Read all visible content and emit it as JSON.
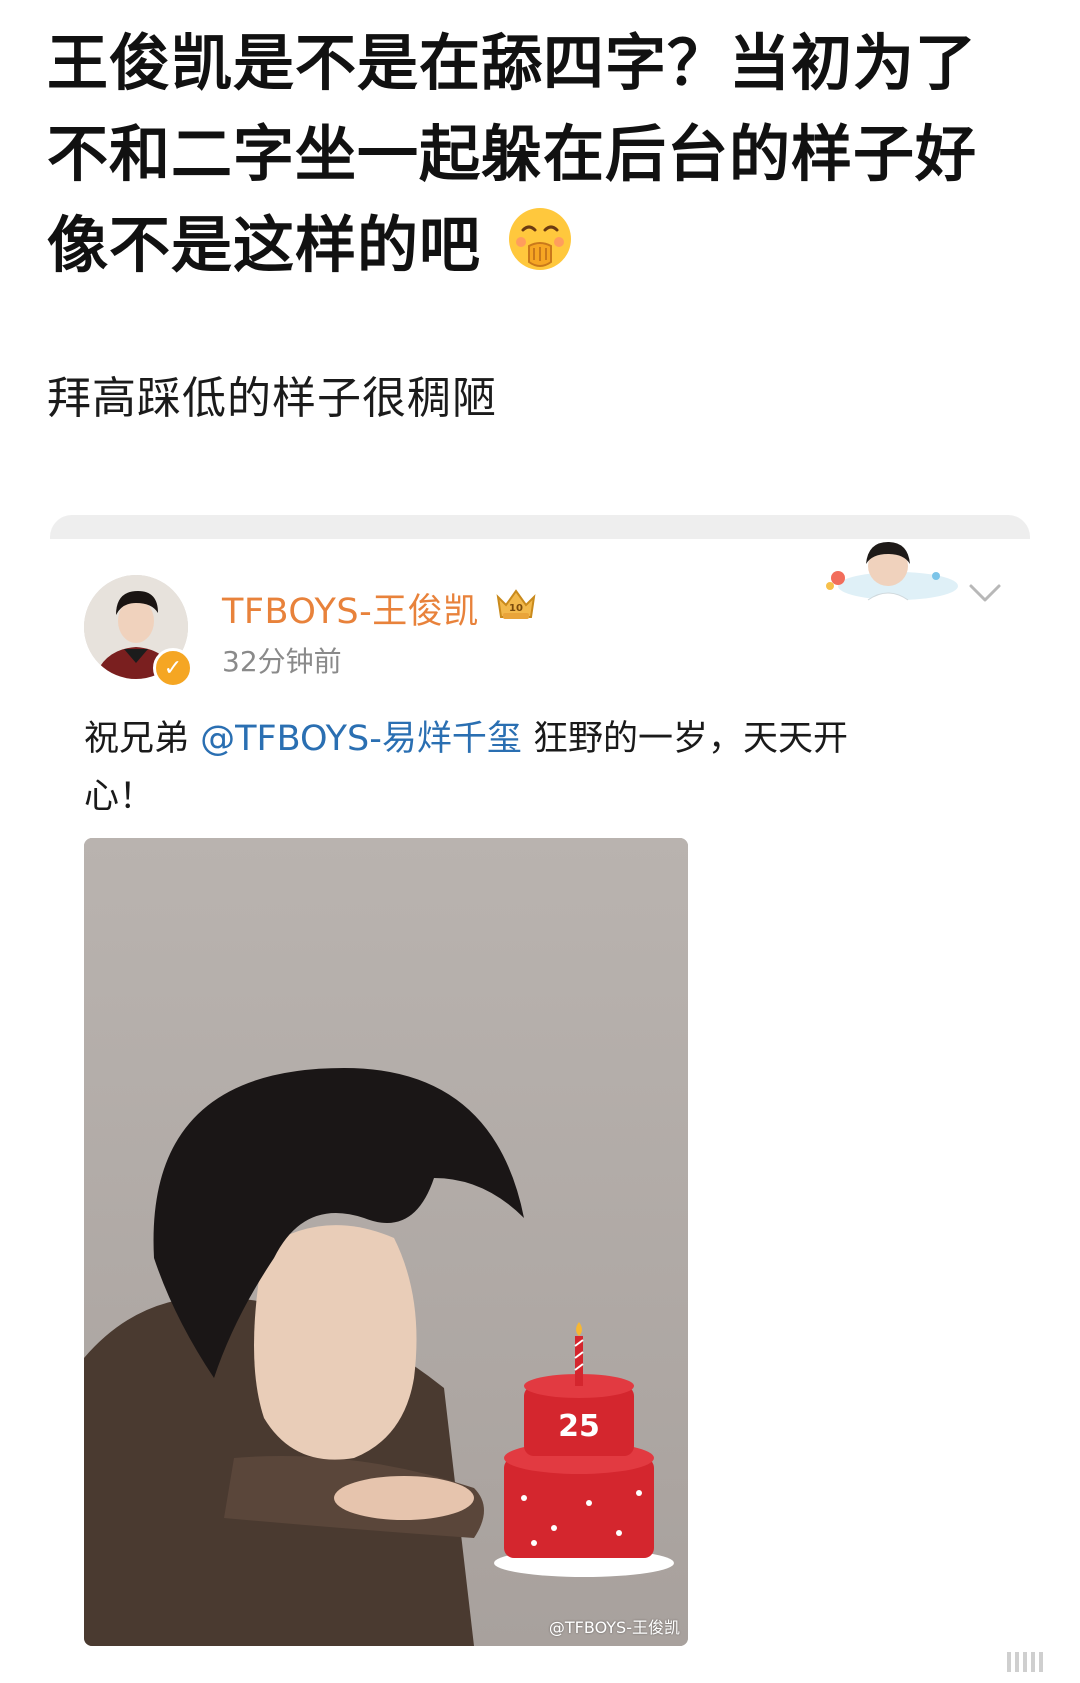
{
  "headline": {
    "line1": "王俊凯是不是在舔四字？当初为了",
    "line2": "不和二字坐一起躲在后台的样子好",
    "line3": "像不是这样的吧"
  },
  "subline": "拜高踩低的样子很稠陋",
  "post": {
    "username": "TFBOYS-王俊凯",
    "time": "32分钟前",
    "text_before": "祝兄弟 ",
    "mention": "@TFBOYS-易烊千玺",
    "text_after": " 狂野的一岁，天天开",
    "text_line2": "心！",
    "cake_number": "25",
    "watermark": "@TFBOYS-王俊凯"
  },
  "icons": {
    "emoji": "hand-over-mouth-emoji",
    "verify": "verified-badge-icon",
    "crown": "crown-badge-icon",
    "chevron": "chevron-down-icon"
  },
  "colors": {
    "username": "#e8823b",
    "mention": "#2a6fb2",
    "verify": "#f5a623",
    "cake": "#d4262e"
  }
}
